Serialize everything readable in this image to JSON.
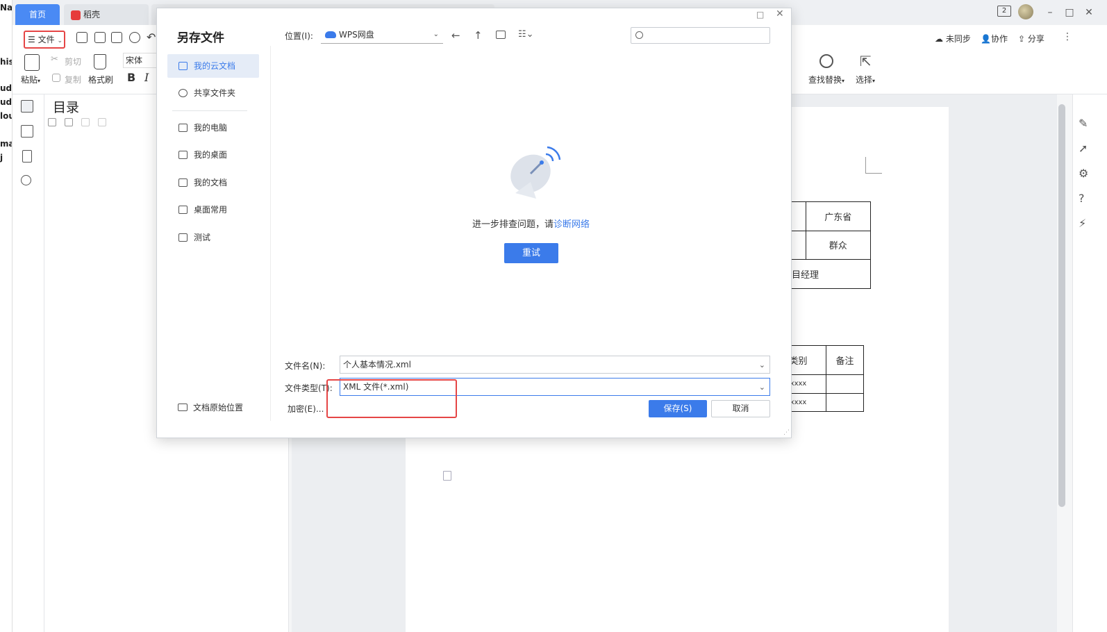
{
  "desktop_left": {
    "items": [
      "Na",
      "his",
      "ud-",
      "ud-",
      "lou",
      "mai",
      "j"
    ]
  },
  "tabs": {
    "home": "首页",
    "daoke": "稻壳"
  },
  "window": {
    "badge": "2"
  },
  "toolbar": {
    "file_menu": "文件",
    "paste": "粘贴",
    "cut": "剪切",
    "copy": "复制",
    "format_painter": "格式刷",
    "font_name": "宋体",
    "bold": "B",
    "italic": "I",
    "find_replace": "查找替换",
    "select": "选择",
    "unsynced": "未同步",
    "collaborate": "协作",
    "share": "分享"
  },
  "toc": {
    "title": "目录"
  },
  "document": {
    "table1": {
      "province": "广东省",
      "political": "群众",
      "position_partial": "目经理"
    },
    "table2": {
      "col_type_partial": "类别",
      "col_note": "备注",
      "cell1": "xxxx",
      "cell2": "xxxx"
    }
  },
  "dialog": {
    "title": "另存文件",
    "location_label": "位置(I):",
    "location_value": "WPS网盘",
    "sidebar": [
      {
        "label": "我的云文档",
        "icon": "cloud-doc-icon",
        "active": true
      },
      {
        "label": "共享文件夹",
        "icon": "shared-folder-icon",
        "active": false
      },
      {
        "label": "我的电脑",
        "icon": "computer-icon",
        "active": false
      },
      {
        "label": "我的桌面",
        "icon": "desktop-icon",
        "active": false
      },
      {
        "label": "我的文档",
        "icon": "folder-icon",
        "active": false
      },
      {
        "label": "桌面常用",
        "icon": "folder-icon",
        "active": false
      },
      {
        "label": "测试",
        "icon": "folder-icon",
        "active": false
      }
    ],
    "original_location": "文档原始位置",
    "hint_text": "进一步排查问题，请",
    "hint_link": "诊断网络",
    "retry": "重试",
    "filename_label": "文件名(N):",
    "filename_value": "个人基本情况.xml",
    "filetype_label": "文件类型(T):",
    "filetype_value": "XML 文件(*.xml)",
    "encrypt": "加密(E)...",
    "save": "保存(S)",
    "cancel": "取消"
  },
  "colors": {
    "accent": "#3b7bea",
    "tab_active": "#4a8af4",
    "highlight": "#e54545"
  }
}
